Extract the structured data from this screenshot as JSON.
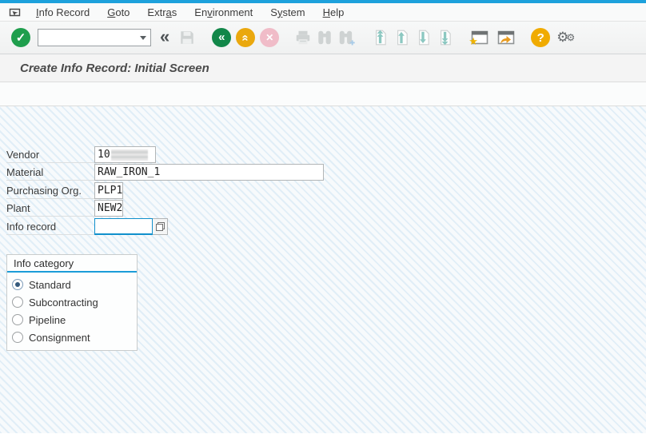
{
  "window": {
    "top_accent_color": "#1da1dc"
  },
  "menu": {
    "items": [
      {
        "pre": "",
        "key": "I",
        "post": "nfo Record"
      },
      {
        "pre": "",
        "key": "G",
        "post": "oto"
      },
      {
        "pre": "Extr",
        "key": "a",
        "post": "s"
      },
      {
        "pre": "En",
        "key": "v",
        "post": "ironment"
      },
      {
        "pre": "S",
        "key": "y",
        "post": "stem"
      },
      {
        "pre": "",
        "key": "H",
        "post": "elp"
      }
    ]
  },
  "toolbar": {
    "command_field": {
      "value": "",
      "placeholder": ""
    },
    "icons": {
      "enter": "✓",
      "back": "«",
      "exit": "«",
      "cancel": "✕",
      "help": "?",
      "gear": "⚙",
      "collapse": "«",
      "star": "★"
    }
  },
  "titlebar": {
    "title": "Create Info Record: Initial Screen"
  },
  "form": {
    "fields": [
      {
        "label": "Vendor",
        "value": "10",
        "redacted": true
      },
      {
        "label": "Material",
        "value": "RAW_IRON_1"
      },
      {
        "label": "Purchasing Org.",
        "value": "PLP1"
      },
      {
        "label": "Plant",
        "value": "NEW2"
      },
      {
        "label": "Info record",
        "value": "",
        "focused": true,
        "has_matchcode": true
      }
    ]
  },
  "info_category": {
    "title": "Info category",
    "options": [
      {
        "label": "Standard",
        "selected": true
      },
      {
        "label": "Subcontracting",
        "selected": false
      },
      {
        "label": "Pipeline",
        "selected": false
      },
      {
        "label": "Consignment",
        "selected": false
      }
    ]
  },
  "colors": {
    "accent_blue": "#1da1dc",
    "focus_border": "#1190cc",
    "group_title_line": "#1b9cd8",
    "enter_green": "#1f9e4d",
    "exit_amber": "#eaa80e",
    "cancel_pink": "#f0bcc8",
    "help_amber": "#f0ab00",
    "page_arrow_teal": "#8cc8c1",
    "star_yellow": "#f0b400",
    "shortcut_orange": "#e89b20"
  }
}
